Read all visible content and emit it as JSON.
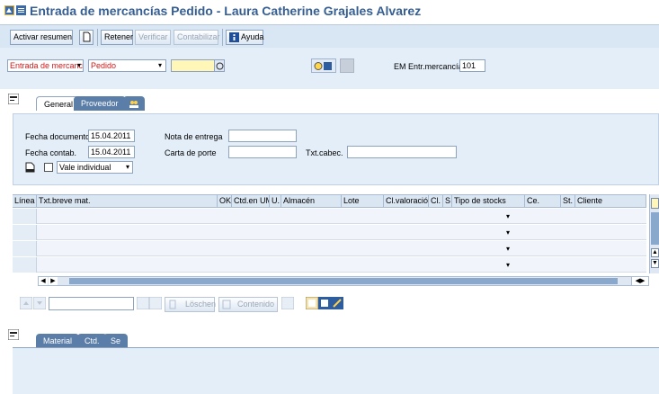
{
  "window": {
    "title": "Entrada de mercancías Pedido - Laura Catherine Grajales Alvarez"
  },
  "toolbar": {
    "activar_resumen": "Activar resumen",
    "retener": "Retener",
    "verificar": "Verificar",
    "contabilizar": "Contabilizar",
    "ayuda": "Ayuda"
  },
  "header": {
    "action_value": "Entrada de mercancí",
    "reference_value": "Pedido",
    "order_value": "",
    "em_label": "EM Entr.mercancías",
    "em_value": "101"
  },
  "tabs": [
    {
      "label": "General"
    },
    {
      "label": "Proveedor"
    }
  ],
  "general": {
    "fecha_documento_label": "Fecha documento",
    "fecha_documento_value": "15.04.2011",
    "fecha_contab_label": "Fecha contab.",
    "fecha_contab_value": "15.04.2011",
    "nota_entrega_label": "Nota de entrega",
    "carta_porte_label": "Carta de porte",
    "txt_cabec_label": "Txt.cabec.",
    "vale_value": "Vale individual"
  },
  "table": {
    "columns": [
      "Línea",
      "Txt.breve mat.",
      "OK",
      "Ctd.en UME",
      "U.",
      "Almacén",
      "Lote",
      "Cl.valoración",
      "Cl.",
      "S",
      "Tipo de stocks",
      "Ce.",
      "St.",
      "Cliente"
    ],
    "row_count": 4
  },
  "item_toolbar": {
    "loschen": "Löschen",
    "contenido": "Contenido"
  },
  "detail_tabs": [
    {
      "label": "Material"
    },
    {
      "label": "Ctd."
    },
    {
      "label": "Se"
    }
  ]
}
